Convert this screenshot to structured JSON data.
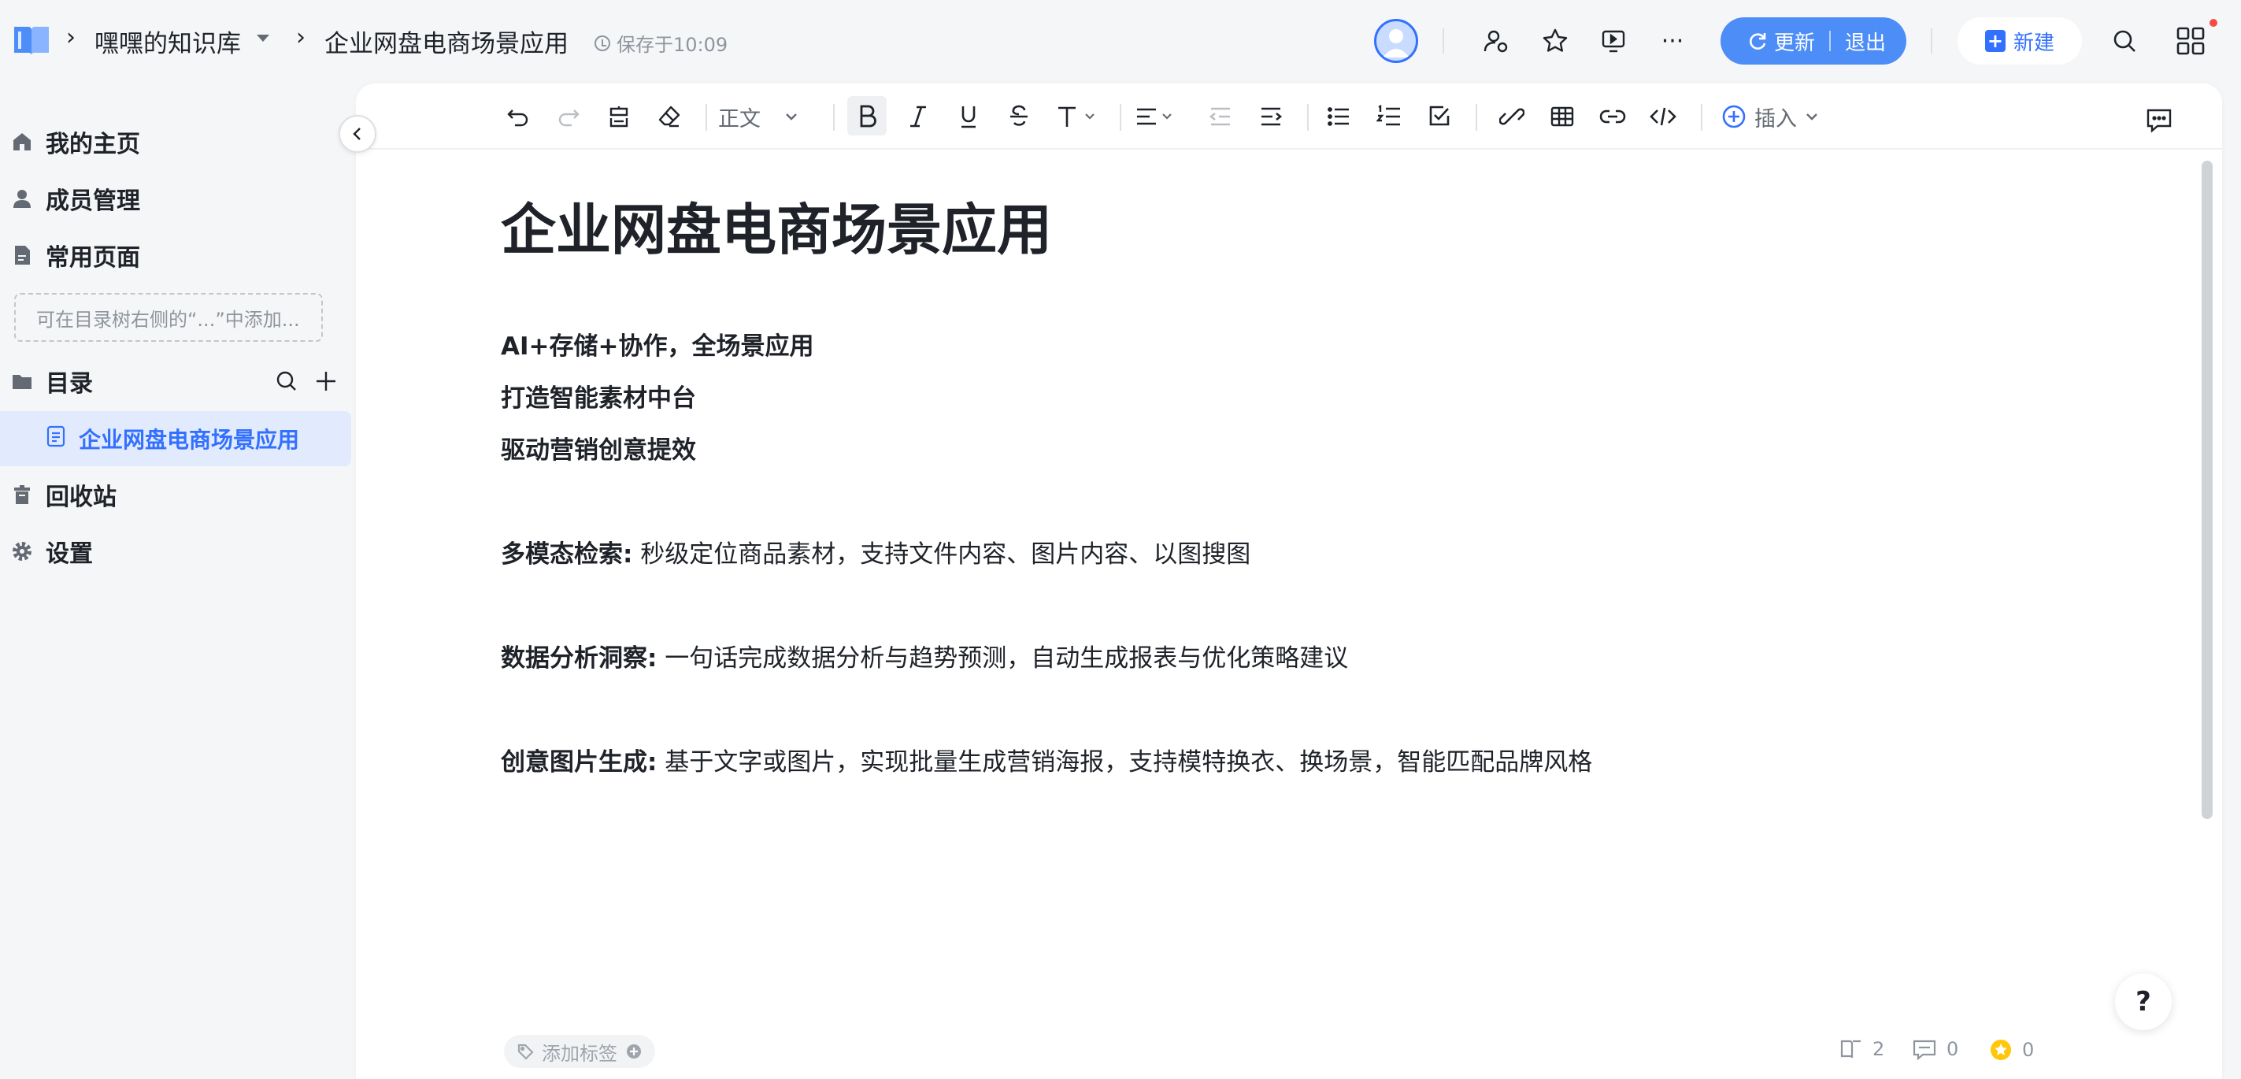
{
  "header": {
    "kb_name": "嘿嘿的知识库",
    "doc_title": "企业网盘电商场景应用",
    "save_status": "保存于10:09",
    "update_label": "更新",
    "exit_label": "退出",
    "new_label": "新建"
  },
  "sidebar": {
    "items": [
      {
        "label": "我的主页",
        "icon": "home-icon"
      },
      {
        "label": "成员管理",
        "icon": "member-icon"
      },
      {
        "label": "常用页面",
        "icon": "page-icon"
      }
    ],
    "add_hint": "可在目录树右侧的“...”中添加...",
    "catalog_label": "目录",
    "tree_items": [
      {
        "label": "企业网盘电商场景应用"
      }
    ],
    "bottom_items": [
      {
        "label": "回收站",
        "icon": "trash-icon"
      },
      {
        "label": "设置",
        "icon": "gear-icon"
      }
    ]
  },
  "toolbar": {
    "text_style": "正文",
    "insert_label": "插入"
  },
  "document": {
    "title": "企业网盘电商场景应用",
    "lines": [
      "AI+存储+协作，全场景应用",
      "打造智能素材中台",
      "驱动营销创意提效"
    ],
    "features": [
      {
        "term": "多模态检索:",
        "desc": " 秒级定位商品素材，支持文件内容、图片内容、以图搜图"
      },
      {
        "term": "数据分析洞察:",
        "desc": " 一句话完成数据分析与趋势预测，自动生成报表与优化策略建议"
      },
      {
        "term": "创意图片生成:",
        "desc": " 基于文字或图片，实现批量生成营销海报，支持模特换衣、换场景，智能匹配品牌风格"
      }
    ]
  },
  "footer": {
    "add_tag": "添加标签",
    "reads": "2",
    "comments": "0",
    "likes": "0"
  },
  "help_label": "?",
  "colors": {
    "accent": "#3370ff",
    "update_button": "#4c8df8",
    "selected_bg": "#e2ebfd",
    "badge_dot": "#f54a45"
  }
}
